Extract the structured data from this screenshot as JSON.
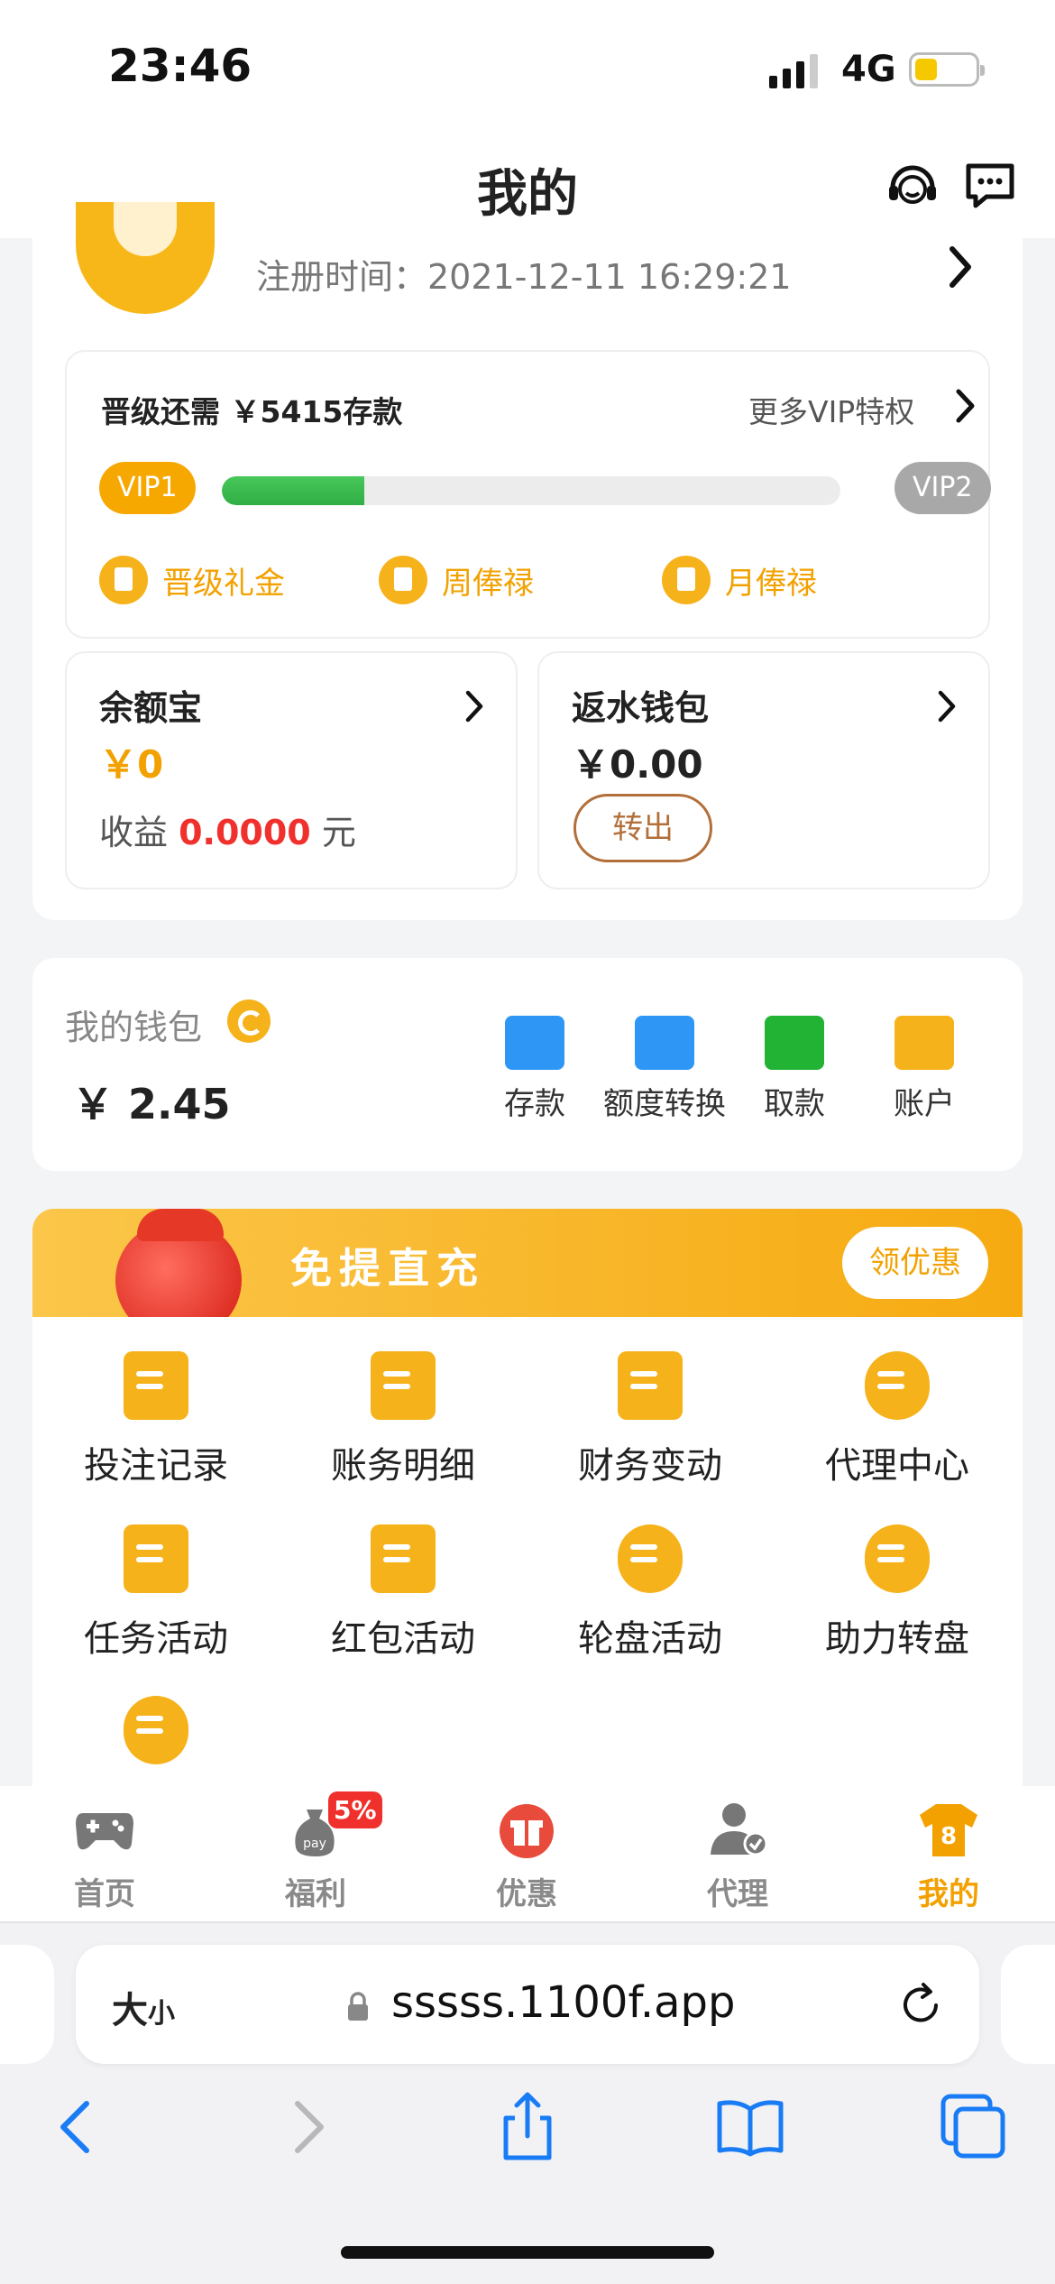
{
  "status_bar": {
    "time": "23:46",
    "network": "4G"
  },
  "header": {
    "title": "我的",
    "icons": [
      "headset-icon",
      "chat-icon"
    ]
  },
  "profile": {
    "register_time": "注册时间：2021-12-11 16:29:21",
    "vip": {
      "need_text": "晋级还需 ￥5415存款",
      "more_text": "更多VIP特权",
      "current_level": "VIP1",
      "next_level": "VIP2",
      "progress": 0.23,
      "perks": [
        "晋级礼金",
        "周俸禄",
        "月俸禄"
      ]
    },
    "yuebao": {
      "title": "余额宝",
      "amount": "￥0",
      "earnings_label": "收益",
      "earnings_value": "0.0000",
      "earnings_unit": "元"
    },
    "rebate_wallet": {
      "title": "返水钱包",
      "amount": "￥0.00",
      "transfer_label": "转出"
    }
  },
  "wallet": {
    "title": "我的钱包",
    "amount": "￥ 2.45",
    "actions": [
      {
        "label": "存款",
        "color": "#2e97f5"
      },
      {
        "label": "额度转换",
        "color": "#2e97f5"
      },
      {
        "label": "取款",
        "color": "#22b335"
      },
      {
        "label": "账户",
        "color": "#f6b21a"
      }
    ]
  },
  "promo": {
    "title": "免提直充",
    "button": "领优惠"
  },
  "menu": {
    "items": [
      {
        "label": "投注记录"
      },
      {
        "label": "账务明细"
      },
      {
        "label": "财务变动"
      },
      {
        "label": "代理中心"
      },
      {
        "label": "任务活动"
      },
      {
        "label": "红包活动"
      },
      {
        "label": "轮盘活动"
      },
      {
        "label": "助力转盘"
      },
      {
        "label": ""
      }
    ]
  },
  "tabbar": {
    "tabs": [
      {
        "label": "首页",
        "icon": "gamepad-icon"
      },
      {
        "label": "福利",
        "icon": "moneybag-icon",
        "badge": "5%"
      },
      {
        "label": "优惠",
        "icon": "gift-icon"
      },
      {
        "label": "代理",
        "icon": "agent-icon"
      },
      {
        "label": "我的",
        "icon": "shirt-icon",
        "badge": "8",
        "active": true
      }
    ]
  },
  "browser": {
    "text_size": "大",
    "text_size_small": "小",
    "url": "sssss.1100f.app"
  },
  "colors": {
    "accent": "#f2a100",
    "progress": "#2eae44",
    "danger": "#f0302c"
  }
}
